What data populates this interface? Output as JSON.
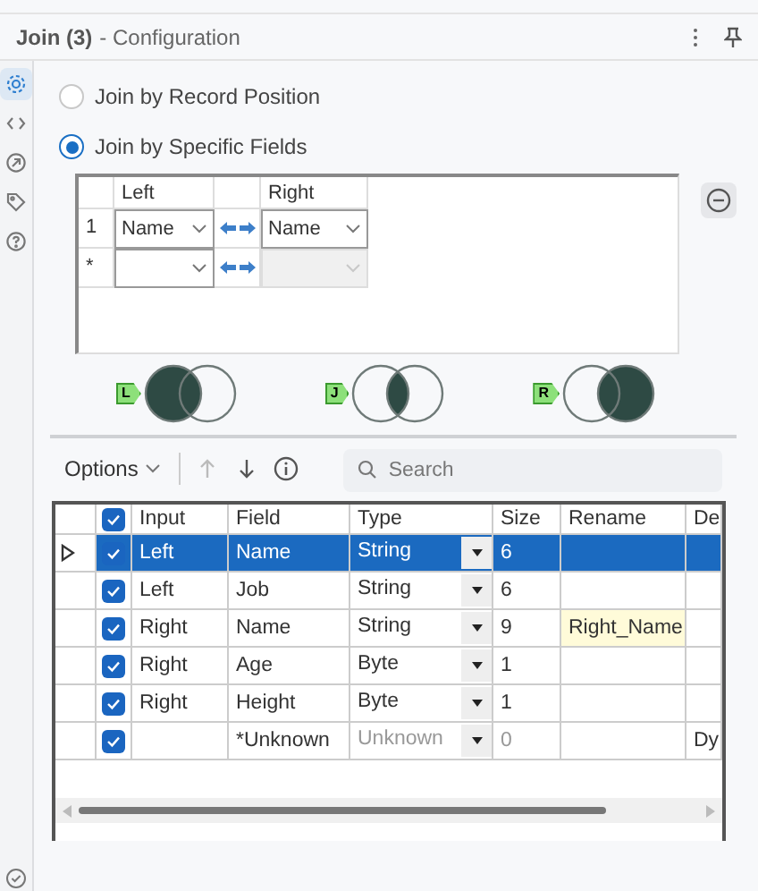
{
  "header": {
    "title": "Join (3)",
    "subtitle": "- Configuration"
  },
  "side_icons": [
    {
      "kind": "gear",
      "selected": true
    },
    {
      "kind": "code",
      "selected": false
    },
    {
      "kind": "annotation",
      "selected": false
    },
    {
      "kind": "tag",
      "selected": false
    },
    {
      "kind": "help",
      "selected": false
    }
  ],
  "join_modes": [
    {
      "label": "Join by Record Position",
      "selected": false
    },
    {
      "label": "Join by Specific Fields",
      "selected": true
    }
  ],
  "join_table": {
    "columns": [
      "Left",
      "Right"
    ],
    "rows": [
      {
        "marker": "1",
        "left": "Name",
        "right": "Name",
        "right_disabled": false
      },
      {
        "marker": "*",
        "right_disabled": true
      }
    ]
  },
  "venn": [
    {
      "badge": "L",
      "kind": "left"
    },
    {
      "badge": "J",
      "kind": "inner"
    },
    {
      "badge": "R",
      "kind": "right"
    }
  ],
  "toolbar": {
    "options": "Options",
    "search_placeholder": "Search"
  },
  "fields_grid": {
    "all_checked": true,
    "columns": [
      "Input",
      "Field",
      "Type",
      "Size",
      "Rename",
      "De"
    ],
    "rows": [
      {
        "selected": true,
        "checked": true,
        "input": "Left",
        "field": "Name",
        "type": "String",
        "size": "6",
        "unknown": false
      },
      {
        "selected": false,
        "checked": true,
        "input": "Left",
        "field": "Job",
        "type": "String",
        "size": "6",
        "unknown": false
      },
      {
        "selected": false,
        "checked": true,
        "input": "Right",
        "field": "Name",
        "type": "String",
        "size": "9",
        "rename": "Right_Name",
        "unknown": false
      },
      {
        "selected": false,
        "checked": true,
        "input": "Right",
        "field": "Age",
        "type": "Byte",
        "size": "1",
        "unknown": false
      },
      {
        "selected": false,
        "checked": true,
        "input": "Right",
        "field": "Height",
        "type": "Byte",
        "size": "1",
        "unknown": false
      },
      {
        "selected": false,
        "checked": true,
        "field": "*Unknown",
        "type": "Unknown",
        "size": "0",
        "unknown": true,
        "column_6": "Dy"
      }
    ]
  }
}
